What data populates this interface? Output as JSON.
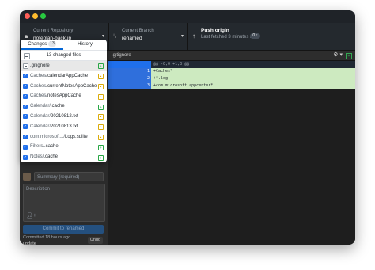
{
  "toolbar": {
    "repo": {
      "label": "Current Repository",
      "value": "noteplan-backup"
    },
    "branch": {
      "label": "Current Branch",
      "value": "renamed"
    },
    "push": {
      "title": "Push origin",
      "subtitle": "Last fetched 3 minutes a..."
    }
  },
  "tabs": {
    "changes_label": "Changes",
    "changes_count": "13",
    "history_label": "History"
  },
  "changes_summary": "13 changed files",
  "files": [
    {
      "dir": "",
      "name": ".gitignore",
      "status": "added",
      "checked": "mixed",
      "selected": true
    },
    {
      "dir": "Caches/",
      "name": "calendarAppCache",
      "status": "modified",
      "checked": "checked",
      "selected": false
    },
    {
      "dir": "Caches/",
      "name": "currentNotesAppCache",
      "status": "modified",
      "checked": "checked",
      "selected": false
    },
    {
      "dir": "Caches/",
      "name": "notesAppCache",
      "status": "modified",
      "checked": "checked",
      "selected": false
    },
    {
      "dir": "Calendar/",
      "name": ".cache",
      "status": "added",
      "checked": "checked",
      "selected": false
    },
    {
      "dir": "Calendar/",
      "name": "20210812.txt",
      "status": "modified",
      "checked": "checked",
      "selected": false
    },
    {
      "dir": "Calendar/",
      "name": "20210813.txt",
      "status": "modified",
      "checked": "checked",
      "selected": false
    },
    {
      "dir": "com.microsoft.../",
      "name": "Logs.sqlite",
      "status": "modified",
      "checked": "checked",
      "selected": false
    },
    {
      "dir": "Filters/",
      "name": ".cache",
      "status": "added",
      "checked": "checked",
      "selected": false
    },
    {
      "dir": "Notes/",
      "name": ".cache",
      "status": "added",
      "checked": "checked",
      "selected": false
    }
  ],
  "diff": {
    "filename": ".gitignore",
    "hunk": "@@ -0,0 +1,3 @@",
    "lines": [
      {
        "num": "1",
        "text": "+Caches*"
      },
      {
        "num": "2",
        "text": "+*.log"
      },
      {
        "num": "3",
        "text": "+com.microsoft.appcenter*"
      }
    ]
  },
  "commit": {
    "summary_placeholder": "Summary (required)",
    "description_placeholder": "Description",
    "button_label": "Commit to renamed",
    "last_commit": "Committed 18 hours ago",
    "last_message": "update",
    "undo_label": "Undo"
  },
  "colors": {
    "accent": "#1f6feb",
    "added": "#28a745",
    "modified": "#dbab09",
    "diff_added_bg": "#cdeac0"
  }
}
